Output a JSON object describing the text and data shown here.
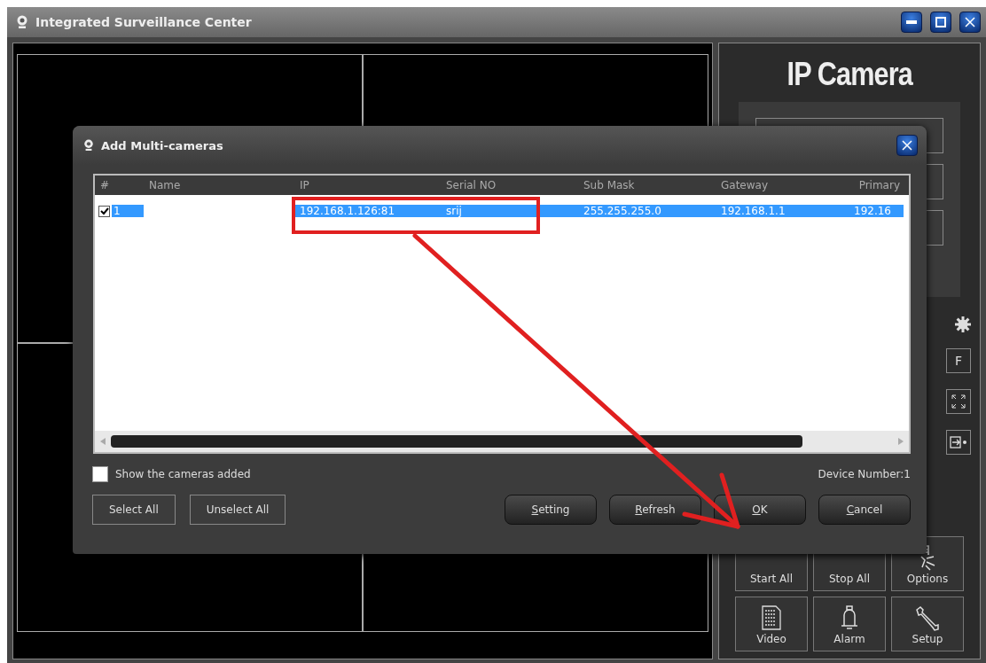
{
  "window": {
    "title": "Integrated Surveillance Center"
  },
  "side_panel": {
    "title": "IP Camera",
    "f_key": "F",
    "buttons": [
      {
        "label": "Start All",
        "kind": "plain"
      },
      {
        "label": "Stop All",
        "kind": "plain"
      },
      {
        "label": "Options",
        "kind": "options"
      },
      {
        "label": "Video",
        "kind": "video"
      },
      {
        "label": "Alarm",
        "kind": "alarm"
      },
      {
        "label": "Setup",
        "kind": "setup"
      }
    ]
  },
  "dialog": {
    "title": "Add Multi-cameras",
    "columns": [
      "#",
      "Name",
      "IP",
      "Serial NO",
      "Sub Mask",
      "Gateway",
      "Primary"
    ],
    "rows": [
      {
        "checked": true,
        "selected": true,
        "cells": [
          "1",
          "",
          "192.168.1.126:81",
          "srij",
          "255.255.255.0",
          "192.168.1.1",
          "192.16"
        ]
      }
    ],
    "show_added": {
      "label": "Show the cameras added",
      "checked": false
    },
    "device_number": "Device Number:1",
    "left_buttons": [
      "Select All",
      "Unselect All"
    ],
    "right_buttons": [
      "Setting",
      "Refresh",
      "OK",
      "Cancel"
    ]
  }
}
